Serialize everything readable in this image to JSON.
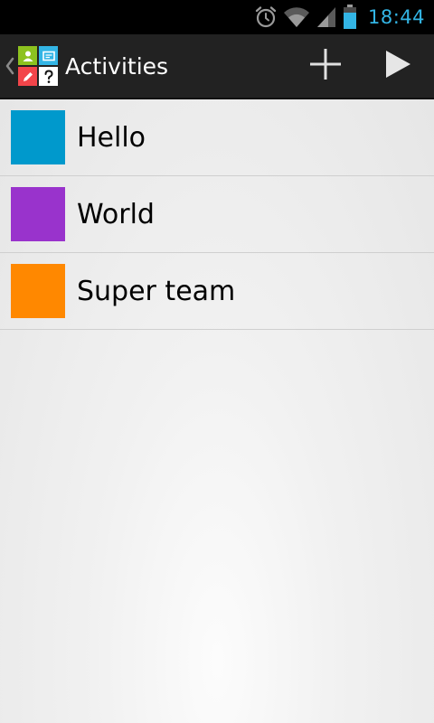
{
  "status_bar": {
    "time": "18:44",
    "icons": [
      "alarm-icon",
      "wifi-icon",
      "signal-icon",
      "battery-icon"
    ],
    "accent_color": "#33b5e5"
  },
  "action_bar": {
    "title": "Activities",
    "actions": [
      {
        "name": "add-button",
        "icon": "plus-icon"
      },
      {
        "name": "play-button",
        "icon": "play-icon"
      }
    ],
    "logo_tile_colors": [
      "#8dc21f",
      "#33b5e5",
      "#f3454a",
      "#ffffff"
    ]
  },
  "activities": [
    {
      "label": "Hello",
      "color": "#0099cc"
    },
    {
      "label": "World",
      "color": "#9933cc"
    },
    {
      "label": "Super team",
      "color": "#ff8800"
    }
  ]
}
